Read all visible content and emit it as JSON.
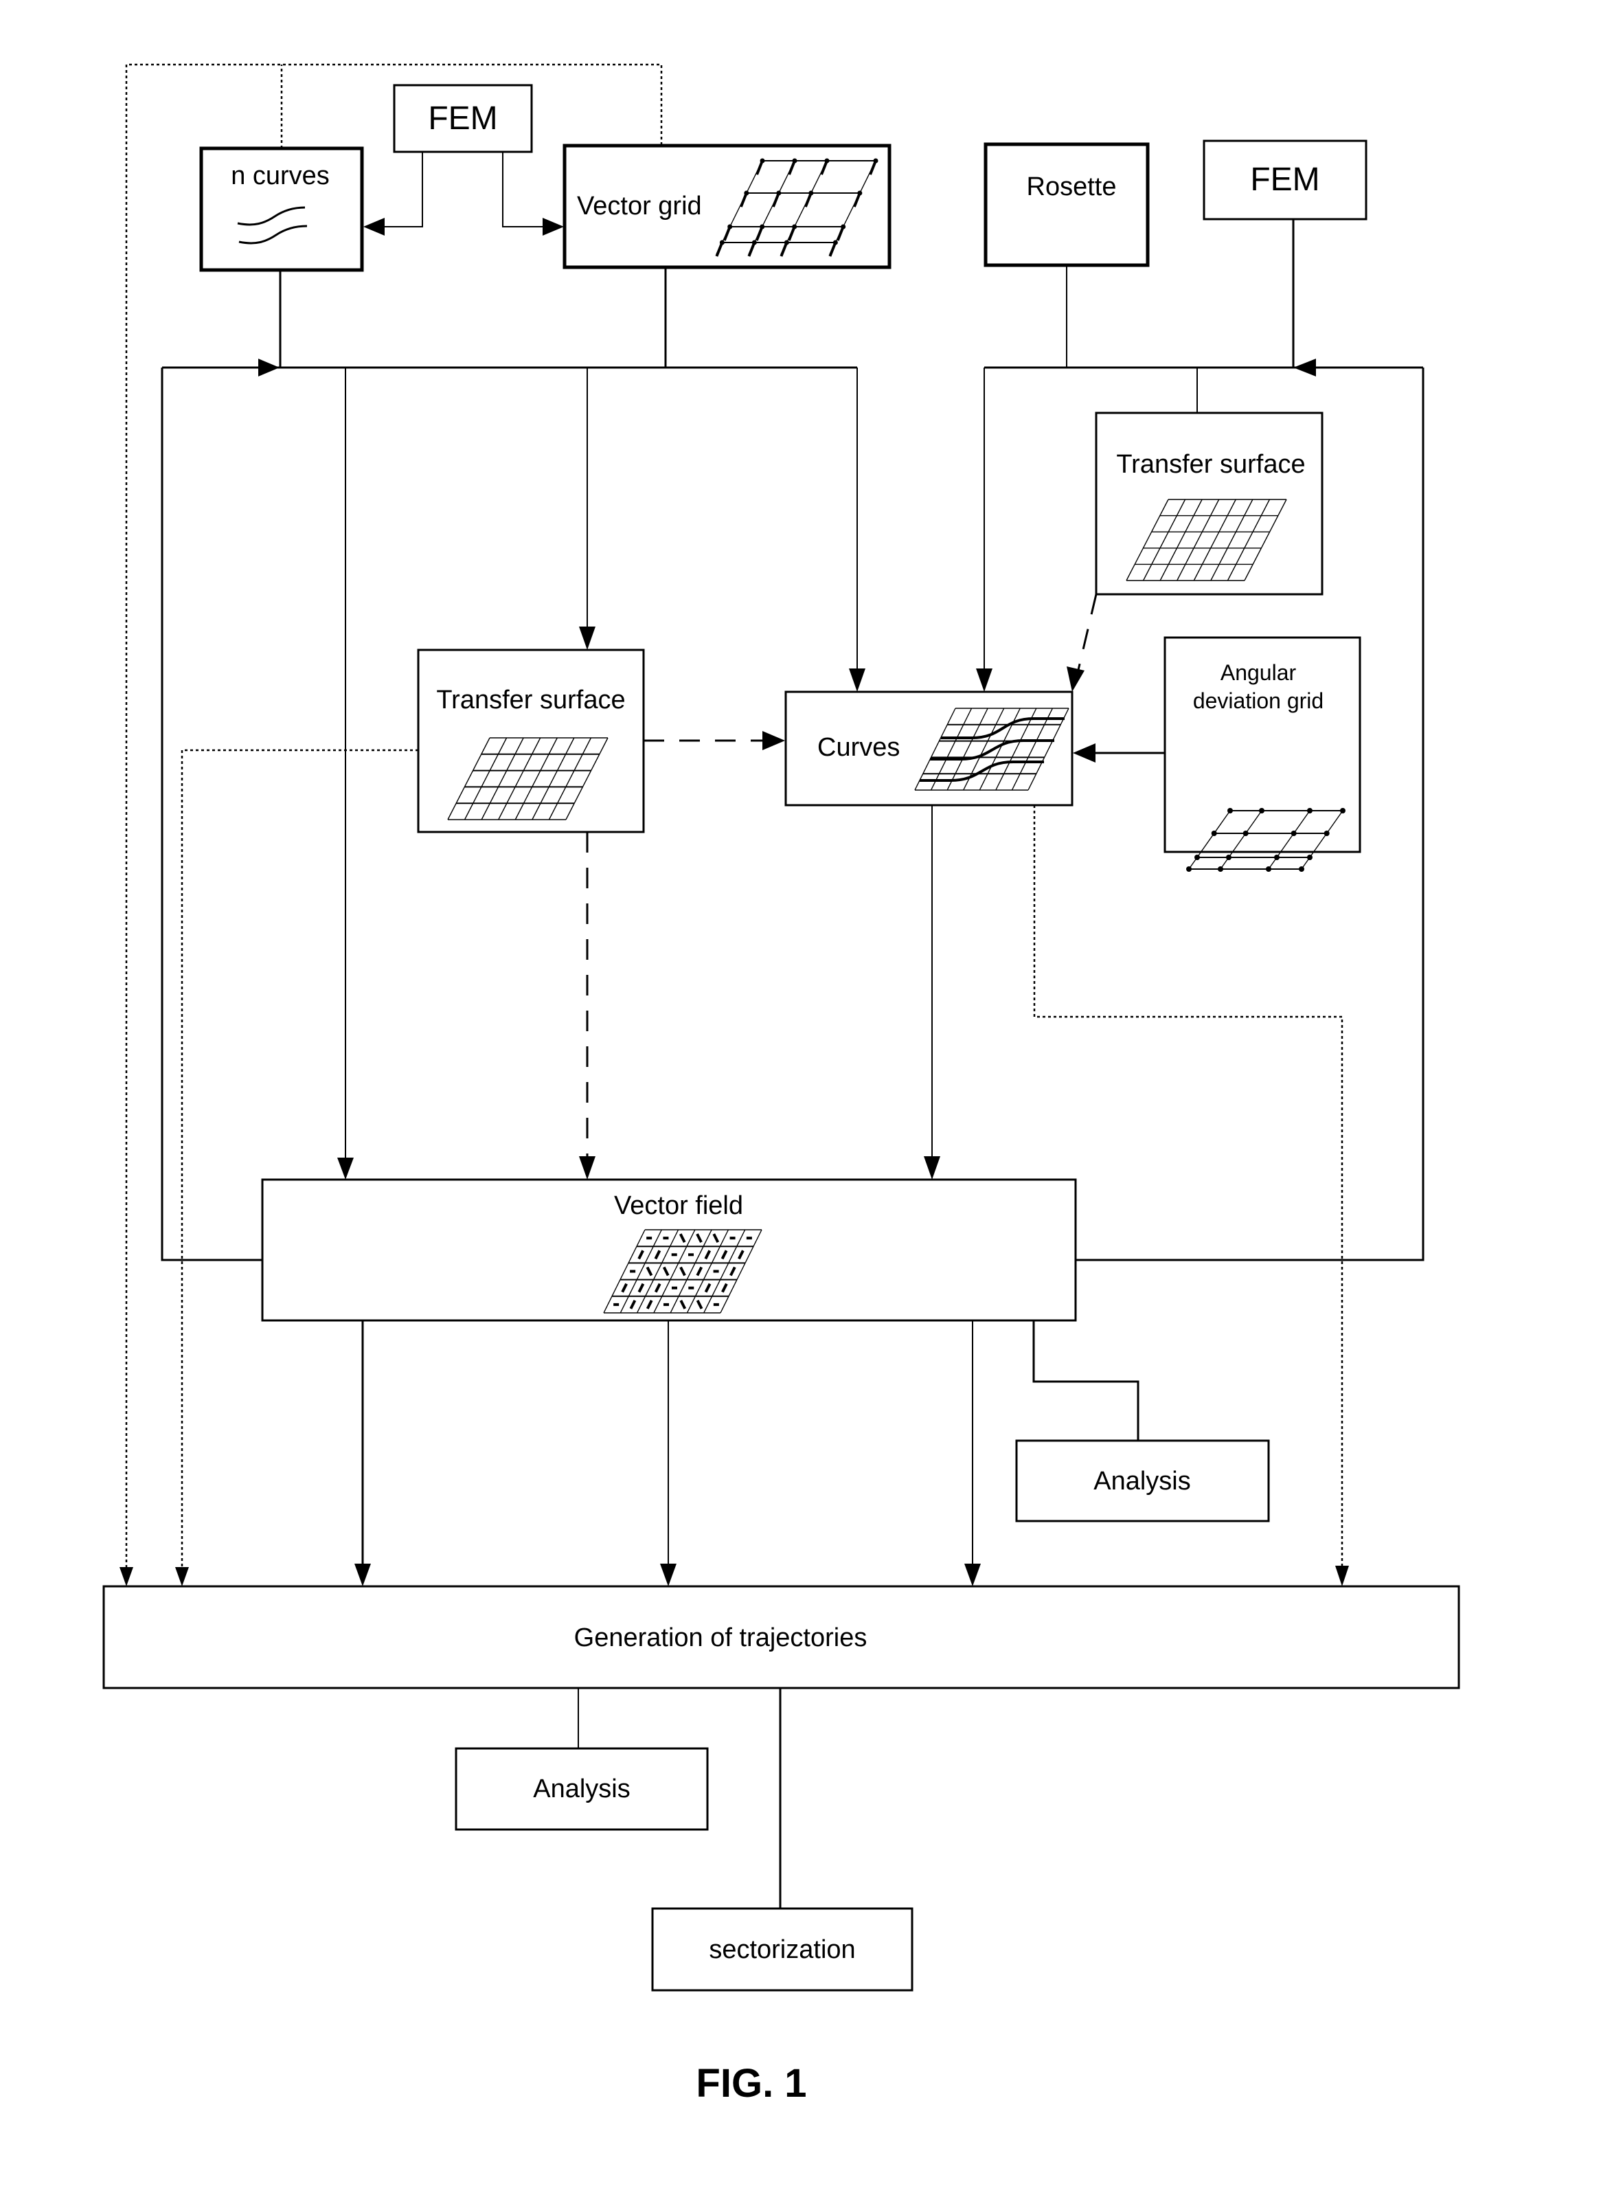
{
  "figure": {
    "title": "FIG. 1",
    "type": "flow-diagram"
  },
  "nodes": {
    "fem_top": {
      "label": "FEM"
    },
    "n_curves": {
      "label": "n curves",
      "icon": "wave-curves-icon"
    },
    "vector_grid": {
      "label": "Vector grid",
      "icon": "vector-grid-icon"
    },
    "rosette": {
      "label": "Rosette"
    },
    "fem_right": {
      "label": "FEM"
    },
    "transfer_surface_right": {
      "label": "Transfer surface",
      "icon": "mesh-grid-icon"
    },
    "transfer_surface_center": {
      "label": "Transfer surface",
      "icon": "mesh-grid-icon"
    },
    "curves": {
      "label": "Curves",
      "icon": "curves-on-grid-icon"
    },
    "angular_deviation_grid": {
      "label_line1": "Angular",
      "label_line2": "deviation grid",
      "icon": "node-grid-icon"
    },
    "vector_field": {
      "label": "Vector field",
      "icon": "vector-field-grid-icon"
    },
    "analysis_right": {
      "label": "Analysis"
    },
    "generation_of_trajectories": {
      "label": "Generation of trajectories"
    },
    "analysis_bottom": {
      "label": "Analysis"
    },
    "sectorization": {
      "label": "sectorization"
    }
  },
  "vector_field_glyphs": [
    [
      "h",
      "h",
      "b",
      "b",
      "b",
      "h",
      "h"
    ],
    [
      "f",
      "f",
      "h",
      "h",
      "f",
      "f",
      "f"
    ],
    [
      "h",
      "b",
      "b",
      "b",
      "f",
      "h",
      "f"
    ],
    [
      "f",
      "f",
      "f",
      "h",
      "h",
      "f",
      "f"
    ],
    [
      "h",
      "f",
      "f",
      "h",
      "b",
      "b",
      "h"
    ]
  ],
  "edges": [
    {
      "from": "fem_top",
      "to": "n_curves",
      "style": "solid"
    },
    {
      "from": "fem_top",
      "to": "vector_grid",
      "style": "solid"
    },
    {
      "from": "n_curves",
      "to": "input_bus_left",
      "style": "solid"
    },
    {
      "from": "vector_grid",
      "to": "input_bus_left",
      "style": "solid"
    },
    {
      "from": "input_bus_left",
      "to": "transfer_surface_center",
      "style": "solid"
    },
    {
      "from": "input_bus_left",
      "to": "curves",
      "style": "solid"
    },
    {
      "from": "input_bus_left",
      "to": "vector_field",
      "style": "solid"
    },
    {
      "from": "vector_field",
      "to": "input_bus_left",
      "style": "solid",
      "note": "feedback loop"
    },
    {
      "from": "rosette",
      "to": "input_bus_right",
      "style": "solid"
    },
    {
      "from": "fem_right",
      "to": "input_bus_right",
      "style": "solid"
    },
    {
      "from": "input_bus_right",
      "to": "curves",
      "style": "solid"
    },
    {
      "from": "input_bus_right",
      "to": "transfer_surface_right",
      "style": "solid"
    },
    {
      "from": "vector_field",
      "to": "input_bus_right",
      "style": "solid",
      "note": "feedback loop"
    },
    {
      "from": "transfer_surface_right",
      "to": "curves",
      "style": "dashed"
    },
    {
      "from": "transfer_surface_center",
      "to": "curves",
      "style": "dashed"
    },
    {
      "from": "angular_deviation_grid",
      "to": "curves",
      "style": "solid"
    },
    {
      "from": "transfer_surface_center",
      "to": "vector_field",
      "style": "dashed"
    },
    {
      "from": "curves",
      "to": "vector_field",
      "style": "solid"
    },
    {
      "from": "curves",
      "to": "generation_of_trajectories",
      "style": "dotted"
    },
    {
      "from": "transfer_surface_center",
      "to": "generation_of_trajectories",
      "style": "dotted"
    },
    {
      "from": "n_curves",
      "to": "generation_of_trajectories",
      "style": "dotted"
    },
    {
      "from": "vector_grid",
      "to": "generation_of_trajectories",
      "style": "dotted"
    },
    {
      "from": "vector_field",
      "to": "generation_of_trajectories",
      "style": "solid",
      "count": 3
    },
    {
      "from": "vector_field",
      "to": "analysis_right",
      "style": "solid"
    },
    {
      "from": "generation_of_trajectories",
      "to": "analysis_bottom",
      "style": "solid"
    },
    {
      "from": "generation_of_trajectories",
      "to": "sectorization",
      "style": "solid"
    }
  ]
}
